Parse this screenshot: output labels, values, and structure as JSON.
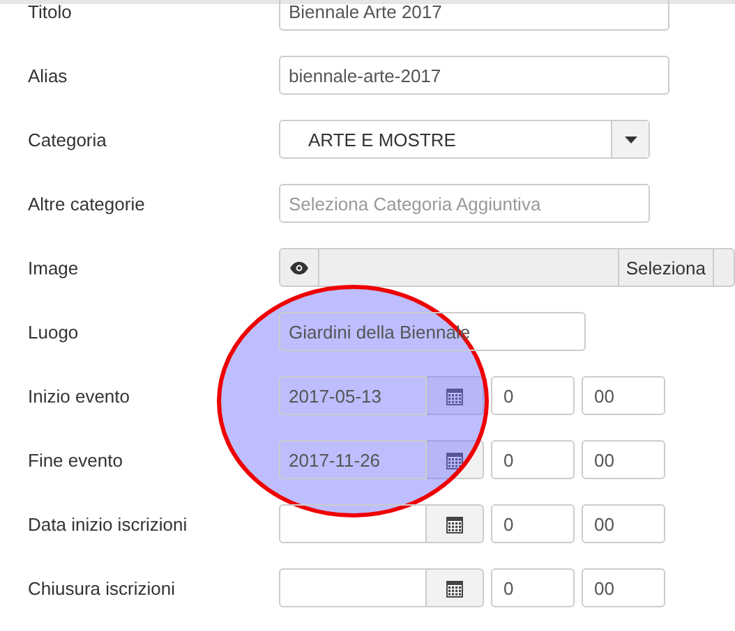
{
  "rows": [
    {
      "kind": "text",
      "label": "Titolo",
      "value": "Biennale Arte 2017",
      "wide": true
    },
    {
      "kind": "text",
      "label": "Alias",
      "value": "biennale-arte-2017",
      "wide": true
    },
    {
      "kind": "select",
      "label": "Categoria",
      "value": "ARTE E MOSTRE"
    },
    {
      "kind": "text",
      "label": "Altre categorie",
      "placeholder": "Seleziona Categoria Aggiuntiva"
    },
    {
      "kind": "media",
      "label": "Image",
      "button": "Seleziona"
    },
    {
      "kind": "text",
      "label": "Luogo",
      "value": "Giardini della Biennale",
      "short": true
    },
    {
      "kind": "datetime",
      "label": "Inizio evento",
      "date": "2017-05-13",
      "hour": "0",
      "minute": "00"
    },
    {
      "kind": "datetime",
      "label": "Fine evento",
      "date": "2017-11-26",
      "hour": "0",
      "minute": "00"
    },
    {
      "kind": "datetime",
      "label": "Data inizio iscrizioni",
      "hour": "0",
      "minute": "00"
    },
    {
      "kind": "datetime",
      "label": "Chiusura iscrizioni",
      "hour": "0",
      "minute": "00"
    }
  ],
  "highlight": {
    "kind": "ellipse"
  }
}
